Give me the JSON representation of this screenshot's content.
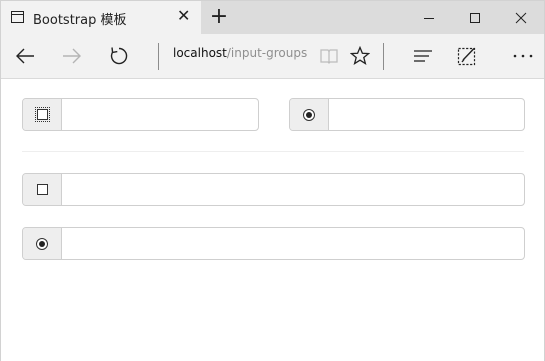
{
  "browser": {
    "tab_title": "Bootstrap 模板",
    "tab_close": "✕",
    "new_tab": "+",
    "url_host": "localhost",
    "url_path": "/input-groups"
  },
  "icons": {
    "page": "page-icon",
    "back": "back-arrow-icon",
    "forward": "forward-arrow-icon",
    "refresh": "refresh-icon",
    "reading_view": "book-icon",
    "favorites": "star-icon",
    "hub": "hub-icon",
    "web_note": "pen-note-icon",
    "more": "more-icon"
  },
  "form": {
    "groups": [
      {
        "addon": "checkbox",
        "checked": false,
        "focused": true,
        "value": ""
      },
      {
        "addon": "radio",
        "checked": true,
        "focused": false,
        "value": ""
      },
      {
        "addon": "checkbox",
        "checked": false,
        "focused": false,
        "value": ""
      },
      {
        "addon": "radio",
        "checked": true,
        "focused": false,
        "value": ""
      }
    ]
  },
  "colors": {
    "chrome": "#f2f2f2",
    "titlebar": "#dcdcdc",
    "addon_bg": "#eeeeee",
    "border": "#cfcfcf"
  }
}
